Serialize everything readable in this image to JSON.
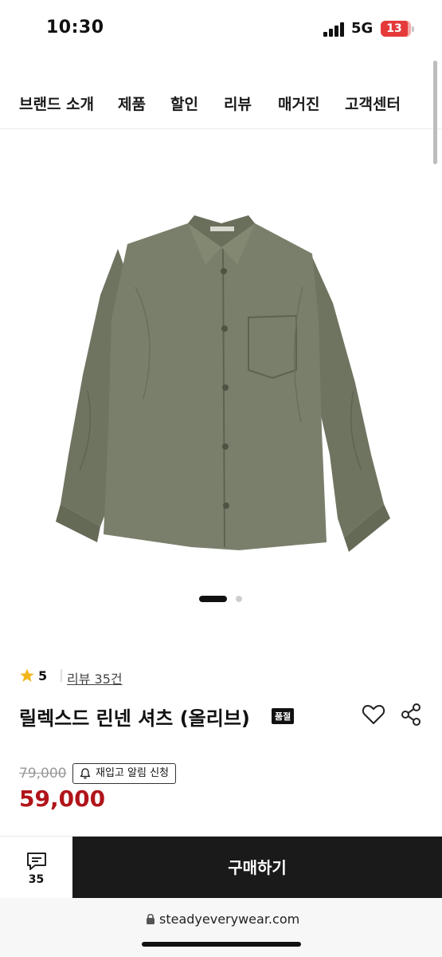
{
  "status_bar": {
    "time": "10:30",
    "network": "5G",
    "battery": "13"
  },
  "nav": {
    "items": [
      "브랜드 소개",
      "제품",
      "할인",
      "리뷰",
      "매거진",
      "고객센터"
    ]
  },
  "product": {
    "image_icon": "olive-linen-shirt-image",
    "carousel": {
      "total": 2,
      "active": 1
    },
    "rating": "5",
    "rating_separator": "|",
    "review_link": "리뷰 35건",
    "title": "릴렉스드 린넨 셔츠 (올리브)",
    "soldout_badge": "품절",
    "original_price": "79,000",
    "restock_label": "재입고 알림 신청",
    "sale_price": "59,000",
    "price_color": "#b1141b",
    "shirt_color": "#7a7f6c"
  },
  "bottom_bar": {
    "comment_count": "35",
    "buy_label": "구매하기"
  },
  "browser": {
    "url": "steadyeverywear.com"
  }
}
